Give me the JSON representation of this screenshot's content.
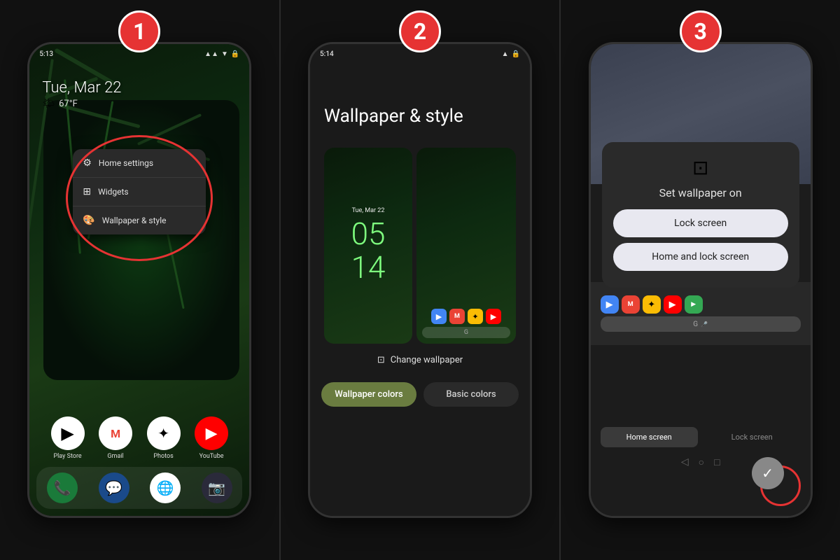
{
  "panels": [
    {
      "id": "panel1",
      "step": "1",
      "phone": {
        "statusBar": {
          "left": "5:13",
          "icons": [
            "▼",
            "✦",
            "♦",
            "▲"
          ]
        },
        "date": "Tue, Mar 22",
        "weather": {
          "icon": "🌤",
          "temp": "67°F"
        },
        "contextMenu": {
          "items": [
            {
              "icon": "⚙",
              "label": "Home settings"
            },
            {
              "icon": "⊞",
              "label": "Widgets"
            },
            {
              "icon": "🎨",
              "label": "Wallpaper & style"
            }
          ]
        },
        "apps": [
          {
            "label": "Play Store",
            "emoji": "▶",
            "bg": "#4285f4"
          },
          {
            "label": "Gmail",
            "emoji": "M",
            "bg": "#ea4335"
          },
          {
            "label": "Photos",
            "emoji": "✦",
            "bg": "#fbbc04"
          },
          {
            "label": "YouTube",
            "emoji": "▶",
            "bg": "#ff0000"
          }
        ],
        "dock": [
          "📞",
          "💬",
          "🌐",
          "📷"
        ]
      }
    },
    {
      "id": "panel2",
      "step": "2",
      "phone": {
        "statusBar": {
          "left": "5:14",
          "icons": [
            "▼",
            "▲"
          ]
        },
        "title": "Wallpaper & style",
        "lockTime": [
          "05",
          "14"
        ],
        "changeWallpaper": "Change wallpaper",
        "tabs": [
          {
            "label": "Wallpaper colors",
            "active": true
          },
          {
            "label": "Basic colors",
            "active": false
          }
        ]
      }
    },
    {
      "id": "panel3",
      "step": "3",
      "phone": {
        "dialog": {
          "icon": "⊡",
          "title": "Set wallpaper on",
          "options": [
            {
              "label": "Lock screen"
            },
            {
              "label": "Home and lock screen"
            }
          ]
        },
        "screenTabs": [
          {
            "label": "Home screen",
            "active": true
          },
          {
            "label": "Lock screen",
            "active": false
          }
        ],
        "confirmIcon": "✓"
      }
    }
  ]
}
